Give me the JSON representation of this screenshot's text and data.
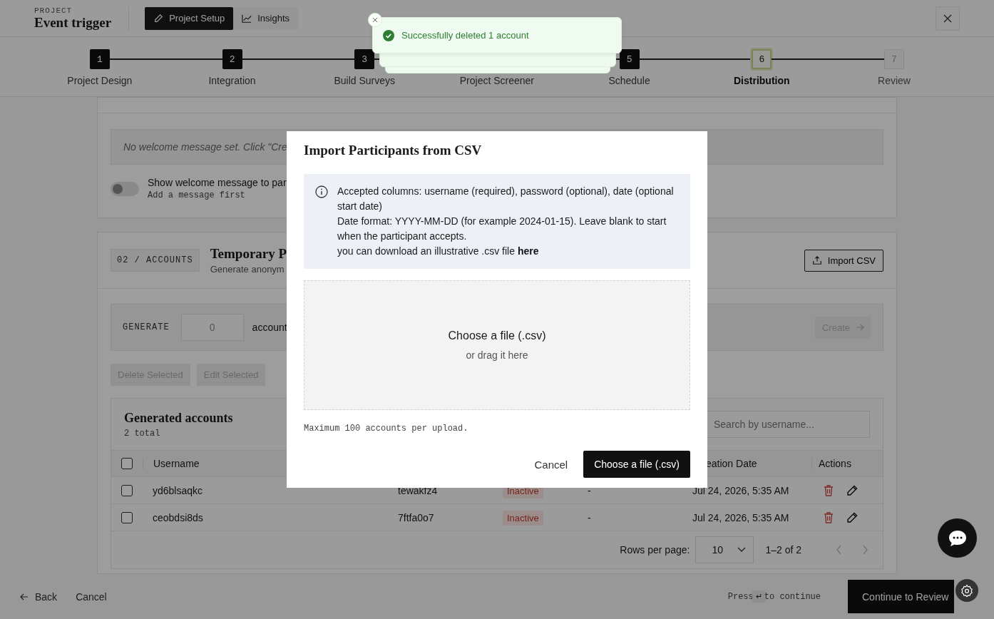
{
  "header": {
    "eyebrow": "PROJECT",
    "title": "Event trigger",
    "tabs": [
      {
        "label": "Project Setup",
        "kind": "pencil",
        "selected": true
      },
      {
        "label": "Insights",
        "kind": "chart",
        "selected": false
      }
    ]
  },
  "stepper": [
    {
      "number": "1",
      "label": "Project Design",
      "done": true,
      "selected": false
    },
    {
      "number": "2",
      "label": "Integration",
      "done": true,
      "selected": false
    },
    {
      "number": "3",
      "label": "Build Surveys",
      "done": true,
      "selected": false
    },
    {
      "label": "Project Screener",
      "done": true,
      "selected": false
    },
    {
      "number": "5",
      "label": "Schedule",
      "done": true,
      "selected": false
    },
    {
      "number": "6",
      "label": "Distribution",
      "done": false,
      "selected": true
    },
    {
      "number": "7",
      "label": "Review",
      "done": false,
      "selected": false
    }
  ],
  "welcome": {
    "message": "No welcome message set. Click \"Cre",
    "toggle_label": "Show welcome message to par",
    "toggle_hint": "Add a message first",
    "on": false
  },
  "accounts": {
    "tag": "02 / ACCOUNTS",
    "title": "Temporary P",
    "subtitle": "Generate anonym",
    "import_button": "Import CSV",
    "generate": {
      "label": "GENERATE",
      "value": "0",
      "suffix": "account",
      "create_button": "Create",
      "disabled": true
    },
    "bulk_actions": [
      {
        "label": "Delete Selected",
        "disabled": true
      },
      {
        "label": "Edit Selected",
        "disabled": true
      }
    ],
    "table": {
      "title": "Generated accounts",
      "count": "2 total",
      "search_placeholder": "Search by username...",
      "all_selected": false,
      "columns": [
        "Username",
        "eation Date",
        "Actions"
      ],
      "rows": [
        {
          "selected": false,
          "username": "yd6blsaqkc",
          "password": "tewakfz4",
          "status": "Inactive",
          "active": false,
          "start_date": "-",
          "created": "Jul 24, 2026, 5:35 AM"
        },
        {
          "selected": false,
          "username": "ceobdsi8ds",
          "password": "7ftfa0o7",
          "status": "Inactive",
          "active": false,
          "start_date": "-",
          "created": "Jul 24, 2026, 5:35 AM"
        }
      ],
      "rows_label": "Rows per page:",
      "rows_per_page": "10",
      "range": "1–2 of 2"
    }
  },
  "footer": {
    "back": "Back",
    "cancel": "Cancel",
    "hint_before": "Press",
    "key": "↵",
    "hint_after": "to continue",
    "primary": "Continue to Review"
  },
  "modal": {
    "title": "Import Participants from CSV",
    "info_lines": [
      "Accepted columns: username (required), password (optional), date (optional start date)",
      "Date format: YYYY-MM-DD (for example 2024-01-15). Leave blank to start when the participant accepts."
    ],
    "download_text": "you can download an illustrative .csv file",
    "download_link": "here",
    "drop_title": "Choose a file (.csv)",
    "drop_hint": "or drag it here",
    "note": "Maximum 100 accounts per upload.",
    "cancel": "Cancel",
    "confirm": "Choose a file (.csv)"
  },
  "toast": {
    "message": "Successfully deleted 1 account"
  }
}
